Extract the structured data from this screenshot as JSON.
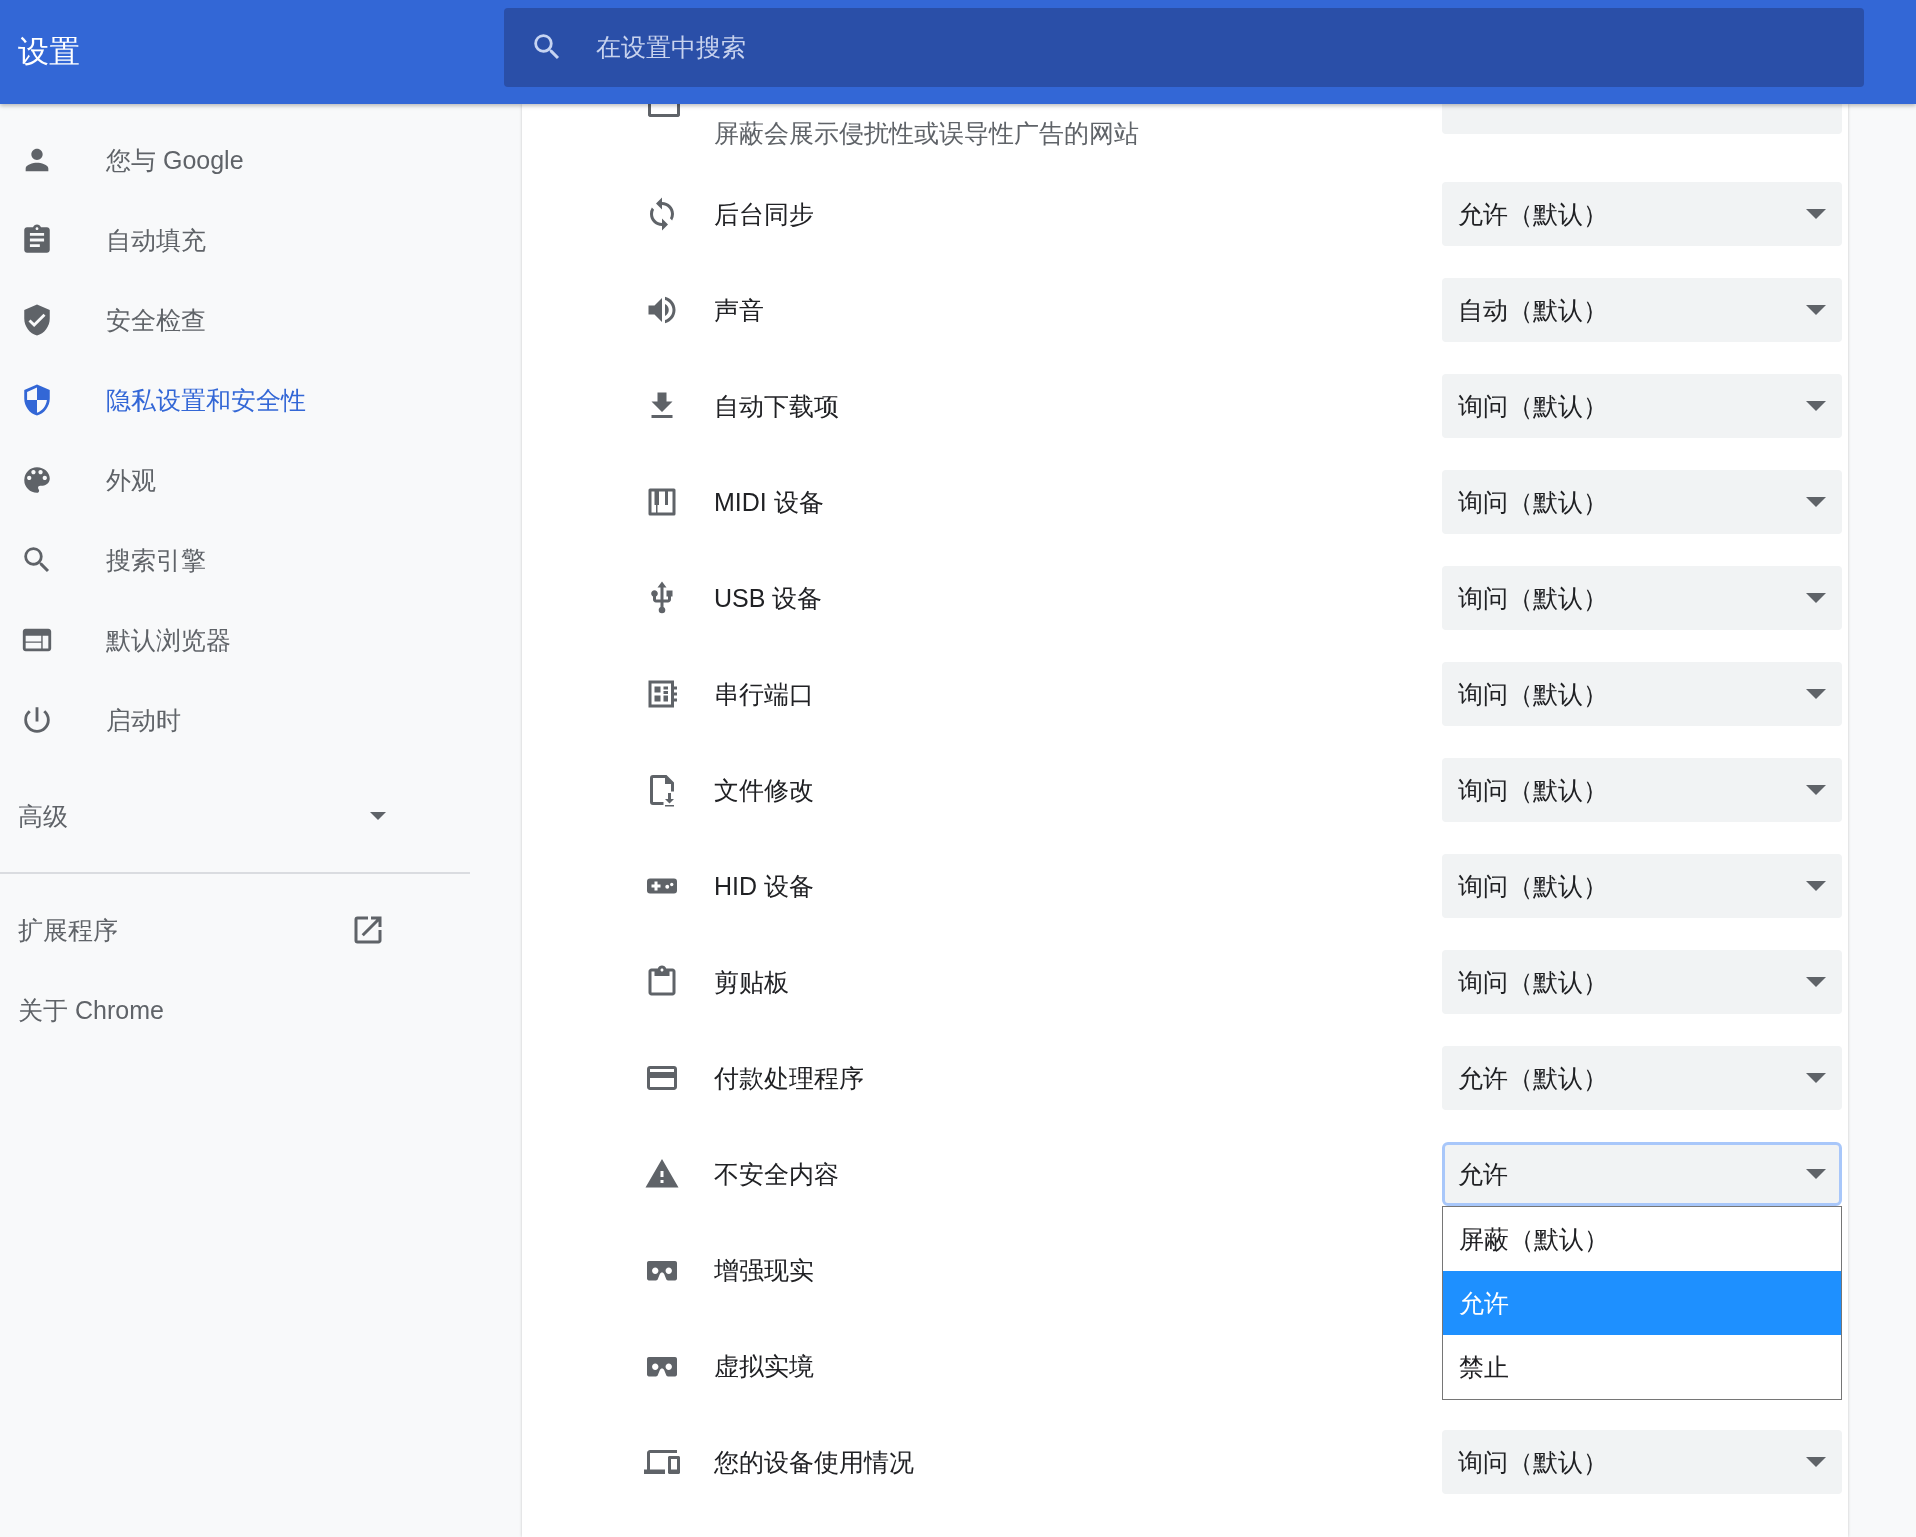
{
  "header": {
    "title": "设置",
    "search_placeholder": "在设置中搜索"
  },
  "sidebar": {
    "items": [
      {
        "label": "您与 Google",
        "selected": false
      },
      {
        "label": "自动填充",
        "selected": false
      },
      {
        "label": "安全检查",
        "selected": false
      },
      {
        "label": "隐私设置和安全性",
        "selected": true
      },
      {
        "label": "外观",
        "selected": false
      },
      {
        "label": "搜索引擎",
        "selected": false
      },
      {
        "label": "默认浏览器",
        "selected": false
      },
      {
        "label": "启动时",
        "selected": false
      }
    ],
    "advanced": {
      "label": "高级",
      "expanded": false
    },
    "links": [
      {
        "label": "扩展程序",
        "external": true
      },
      {
        "label": "关于 Chrome",
        "external": false
      }
    ]
  },
  "content": {
    "top_row": {
      "description": "屏蔽会展示侵扰性或误导性广告的网站"
    },
    "rows": [
      {
        "label": "后台同步",
        "value": "允许（默认）"
      },
      {
        "label": "声音",
        "value": "自动（默认）"
      },
      {
        "label": "自动下载项",
        "value": "询问（默认）"
      },
      {
        "label": "MIDI 设备",
        "value": "询问（默认）"
      },
      {
        "label": "USB 设备",
        "value": "询问（默认）"
      },
      {
        "label": "串行端口",
        "value": "询问（默认）"
      },
      {
        "label": "文件修改",
        "value": "询问（默认）"
      },
      {
        "label": "HID 设备",
        "value": "询问（默认）"
      },
      {
        "label": "剪贴板",
        "value": "询问（默认）"
      },
      {
        "label": "付款处理程序",
        "value": "允许（默认）"
      },
      {
        "label": "不安全内容",
        "value": "允许",
        "options": [
          {
            "label": "屏蔽（默认）",
            "selected": false
          },
          {
            "label": "允许",
            "selected": true
          },
          {
            "label": "禁止",
            "selected": false
          }
        ]
      },
      {
        "label": "增强现实"
      },
      {
        "label": "虚拟实境"
      },
      {
        "label": "您的设备使用情况",
        "value": "询问（默认）"
      }
    ]
  }
}
